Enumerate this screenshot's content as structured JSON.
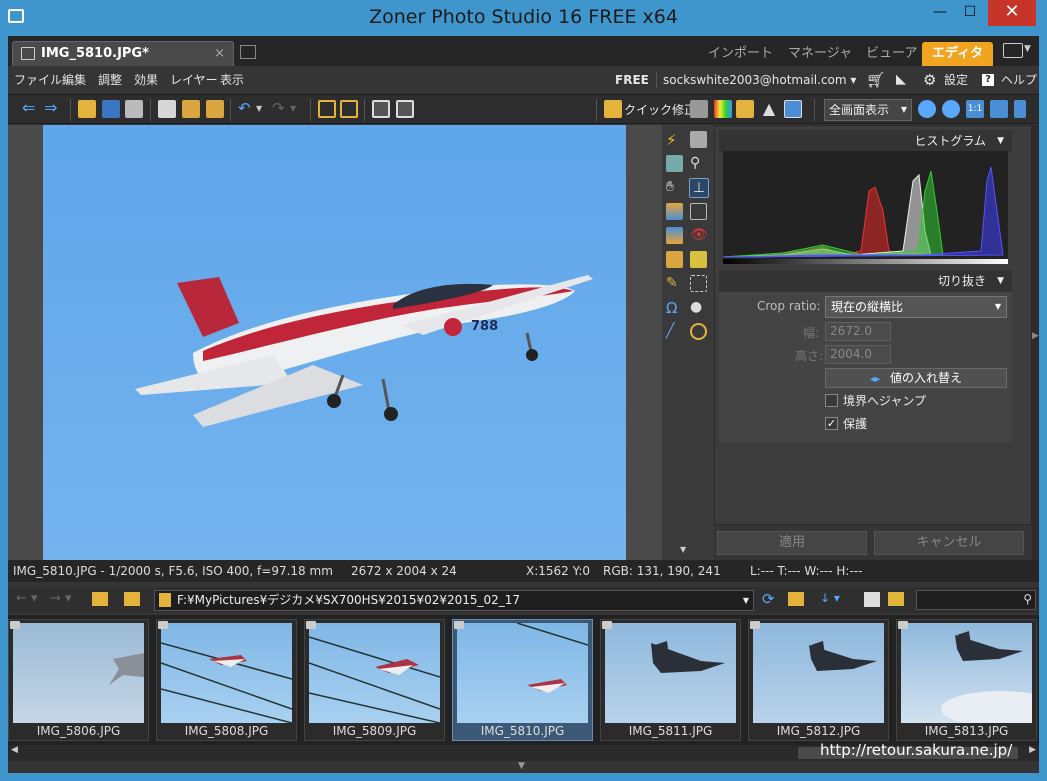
{
  "window": {
    "title": "Zoner Photo Studio 16 FREE x64",
    "minimize": "—",
    "maximize": "☐",
    "close": "✕"
  },
  "doc_tab": {
    "label": "IMG_5810.JPG*",
    "close": "×"
  },
  "mode_tabs": [
    {
      "label": "インポート"
    },
    {
      "label": "マネージャ"
    },
    {
      "label": "ビューア"
    },
    {
      "label": "エディタ",
      "active": true
    }
  ],
  "menu": [
    "ファイル",
    "編集",
    "調整",
    "効果",
    "レイヤー",
    "表示"
  ],
  "account": {
    "edition": "FREE",
    "email": "sockswhite2003@hotmail.com ▾",
    "settings": "設定",
    "help": "ヘルプ"
  },
  "toolbar": {
    "quick_fix": "クイック修正",
    "view_mode": "全画面表示"
  },
  "histogram_panel": {
    "title": "ヒストグラム"
  },
  "crop_panel": {
    "title": "切り抜き",
    "ratio_label": "Crop ratio:",
    "ratio_value": "現在の縦横比",
    "width_label": "幅:",
    "width_value": "2672.0",
    "height_label": "高さ:",
    "height_value": "2004.0",
    "swap_label": "値の入れ替え",
    "snap_label": "境界へジャンプ",
    "snap_checked": false,
    "keep_label": "保護",
    "keep_checked": true
  },
  "actions": {
    "apply": "適用",
    "cancel": "キャンセル"
  },
  "status": {
    "info": "IMG_5810.JPG - 1/2000 s, F5.6, ISO 400, f=97.18 mm",
    "dims": "2672 x 2004 x 24",
    "coords": "X:1562 Y:0",
    "rgb": "RGB: 131, 190, 241",
    "levels": "L:---  T:---  W:---  H:---"
  },
  "browser": {
    "path": "F:¥MyPictures¥デジカメ¥SX700HS¥2015¥02¥2015_02_17"
  },
  "thumbnails": [
    {
      "name": "IMG_5806.JPG",
      "selected": false
    },
    {
      "name": "IMG_5808.JPG",
      "selected": false
    },
    {
      "name": "IMG_5809.JPG",
      "selected": false
    },
    {
      "name": "IMG_5810.JPG",
      "selected": true
    },
    {
      "name": "IMG_5811.JPG",
      "selected": false
    },
    {
      "name": "IMG_5812.JPG",
      "selected": false
    },
    {
      "name": "IMG_5813.JPG",
      "selected": false
    }
  ],
  "watermark": "http://retour.sakura.ne.jp/",
  "colors": {
    "accent": "#f2a421",
    "titlebar": "#3e96cc",
    "sky": "#6aadea",
    "selection": "#3b5977"
  }
}
